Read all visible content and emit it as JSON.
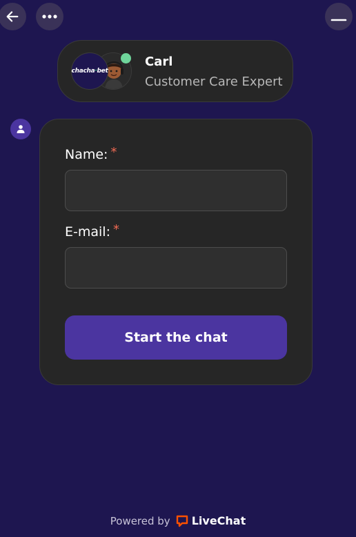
{
  "window": {
    "icons": {
      "back": "arrow-left-icon",
      "more": "more-horizontal-icon",
      "minimize": "minimize-icon"
    }
  },
  "agent": {
    "name": "Carl",
    "role": "Customer Care Expert",
    "status": "online",
    "brand_logo": {
      "text_main": "chacha",
      "text_accent": "bet"
    }
  },
  "form": {
    "name_label": "Name:",
    "email_label": "E-mail:",
    "required_mark": "*",
    "name_value": "",
    "email_value": "",
    "submit_label": "Start the chat"
  },
  "footer": {
    "powered_by": "Powered by",
    "brand": "LiveChat"
  },
  "colors": {
    "background": "#1e1650",
    "card": "#262626",
    "accent": "#4b35a0",
    "online": "#6fd59b",
    "required": "#f16a53",
    "livechat_brand": "#ff5100"
  }
}
